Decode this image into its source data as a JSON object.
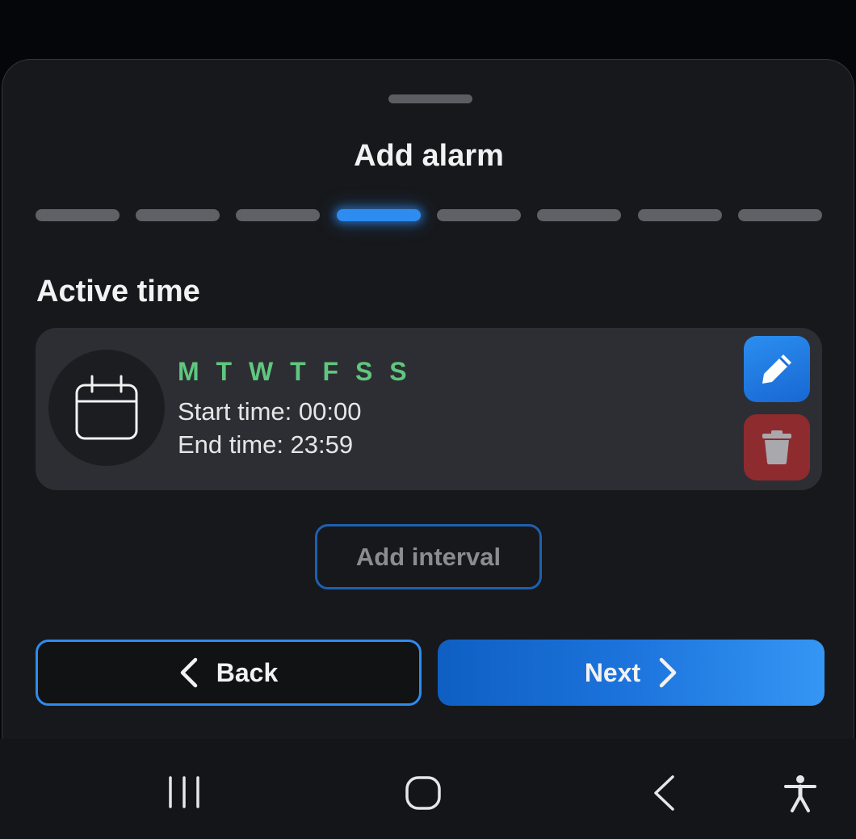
{
  "sheet": {
    "title": "Add alarm",
    "steps_total": 8,
    "current_step": 4
  },
  "active_time": {
    "section_title": "Active time",
    "interval": {
      "days": "M T W T F S S",
      "start_time": "Start time: 00:00",
      "end_time": "End time: 23:59",
      "icon": "calendar-icon"
    },
    "add_interval_label": "Add interval"
  },
  "footer": {
    "back_label": "Back",
    "next_label": "Next"
  },
  "icons": {
    "edit": "pencil-icon",
    "delete": "trash-icon",
    "nav_recents": "recents-icon",
    "nav_home": "home-icon",
    "nav_back": "back-icon",
    "nav_accessibility": "accessibility-icon"
  },
  "colors": {
    "accent": "#2e8bf0",
    "days_green": "#5fc77e",
    "delete_red": "#8e2b2e",
    "card_bg": "#2d2e33",
    "sheet_bg": "#17181b"
  }
}
